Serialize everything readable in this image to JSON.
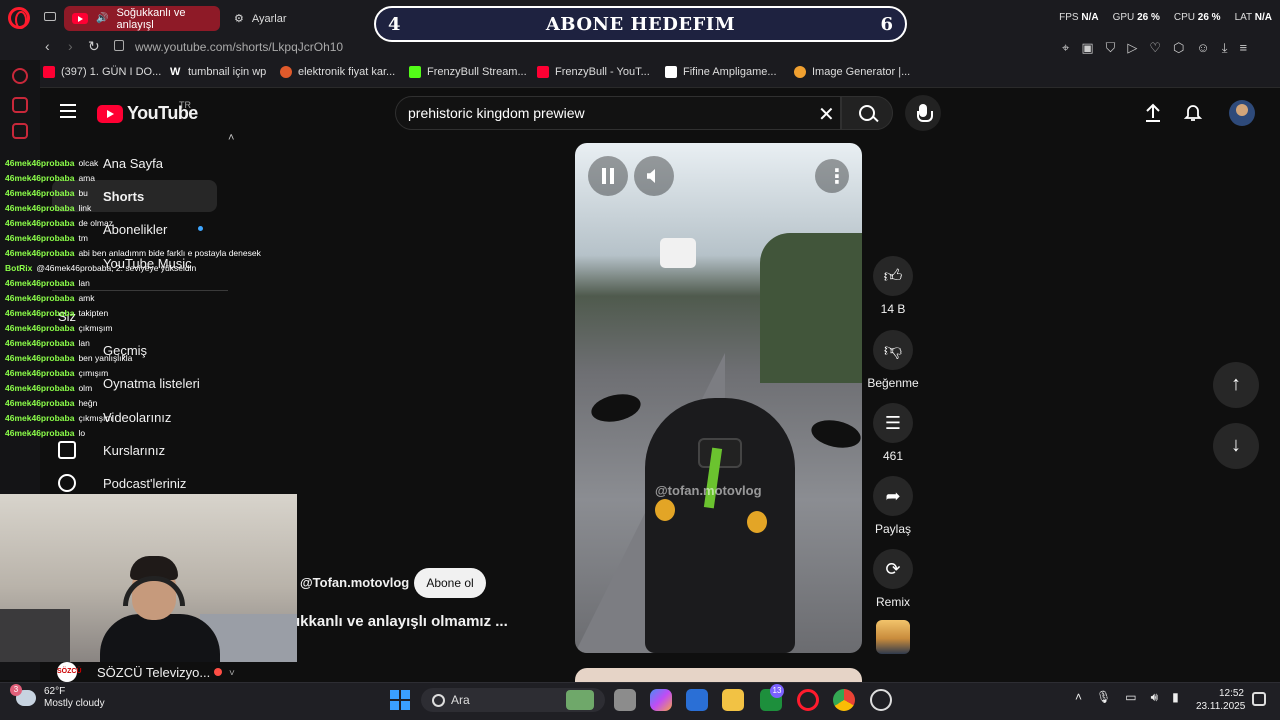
{
  "browser": {
    "tabs": [
      {
        "label": "Soğukkanlı ve anlayışl"
      },
      {
        "label": "Ayarlar"
      }
    ],
    "url": "www.youtube.com/shorts/LkpqJcrOh10",
    "perf": {
      "fps_label": "FPS",
      "fps": "N/A",
      "gpu_label": "GPU",
      "gpu": "26 %",
      "cpu_label": "CPU",
      "cpu": "26 %",
      "lat_label": "LAT",
      "lat": "N/A"
    },
    "bookmarks": [
      {
        "label": "(397) 1. GÜN I DO...",
        "color": "#ff0033"
      },
      {
        "label": "tumbnail için wp",
        "color": "#ffffff"
      },
      {
        "label": "elektronik fiyat kar...",
        "color": "#e05a2b"
      },
      {
        "label": "FrenzyBull Stream...",
        "color": "#53fc18"
      },
      {
        "label": "FrenzyBull - YouT...",
        "color": "#ff0033"
      },
      {
        "label": "Fifine Ampligame...",
        "color": "#ffffff"
      },
      {
        "label": "Image Generator |...",
        "color": "#f0a030"
      }
    ]
  },
  "overlay": {
    "left_num": "4",
    "title": "ABONE HEDEFIM",
    "right_num": "6"
  },
  "youtube": {
    "logo": "YouTube",
    "region": "TR",
    "search_query": "prehistoric kingdom prewiew",
    "sidebar": [
      {
        "label": "Ana Sayfa"
      },
      {
        "label": "Shorts"
      },
      {
        "label": "Abonelikler"
      },
      {
        "label": "YouTube Music"
      },
      {
        "label": "Siz"
      },
      {
        "label": "Geçmiş"
      },
      {
        "label": "Oynatma listeleri"
      },
      {
        "label": "Videolarınız"
      },
      {
        "label": "Kurslarınız"
      },
      {
        "label": "Podcast'leriniz"
      }
    ],
    "subscription": {
      "name": "SÖZCÜ Televizyo...",
      "avatar_text": "SÖZCÜ"
    }
  },
  "short": {
    "watermark": "@tofan.motovlog",
    "channel": "@Tofan.motovlog",
    "subscribe": "Abone ol",
    "title": "ukkanlı ve anlayışlı olmamız ...",
    "likes": "14 B",
    "dislike_label": "Beğenme",
    "comments": "461",
    "share_label": "Paylaş",
    "remix_label": "Remix"
  },
  "chat": [
    {
      "user": "46mek46probaba",
      "msg": "olcak"
    },
    {
      "user": "46mek46probaba",
      "msg": "ama"
    },
    {
      "user": "46mek46probaba",
      "msg": "bu"
    },
    {
      "user": "46mek46probaba",
      "msg": "link"
    },
    {
      "user": "46mek46probaba",
      "msg": "de olmaz"
    },
    {
      "user": "46mek46probaba",
      "msg": "tm"
    },
    {
      "user": "46mek46probaba",
      "msg": "abi ben anladımm bide farklı e postayla denesek"
    },
    {
      "user": "BotRix",
      "msg": "@46mek46probaba, 2. seviyeye yükseldin"
    },
    {
      "user": "46mek46probaba",
      "msg": "lan"
    },
    {
      "user": "46mek46probaba",
      "msg": "amk"
    },
    {
      "user": "46mek46probaba",
      "msg": "takipten"
    },
    {
      "user": "46mek46probaba",
      "msg": "çıkmışım"
    },
    {
      "user": "46mek46probaba",
      "msg": "lan"
    },
    {
      "user": "46mek46probaba",
      "msg": "ben yanlışlıkla"
    },
    {
      "user": "46mek46probaba",
      "msg": "çımışım"
    },
    {
      "user": "46mek46probaba",
      "msg": "olm"
    },
    {
      "user": "46mek46probaba",
      "msg": "heğn"
    },
    {
      "user": "46mek46probaba",
      "msg": "çıkmışım"
    },
    {
      "user": "46mek46probaba",
      "msg": "lo"
    }
  ],
  "taskbar": {
    "weather_badge": "3",
    "temp": "62°F",
    "condition": "Mostly cloudy",
    "search_placeholder": "Ara",
    "time": "12:52",
    "date": "23.11.2025",
    "badge_count": "13"
  }
}
